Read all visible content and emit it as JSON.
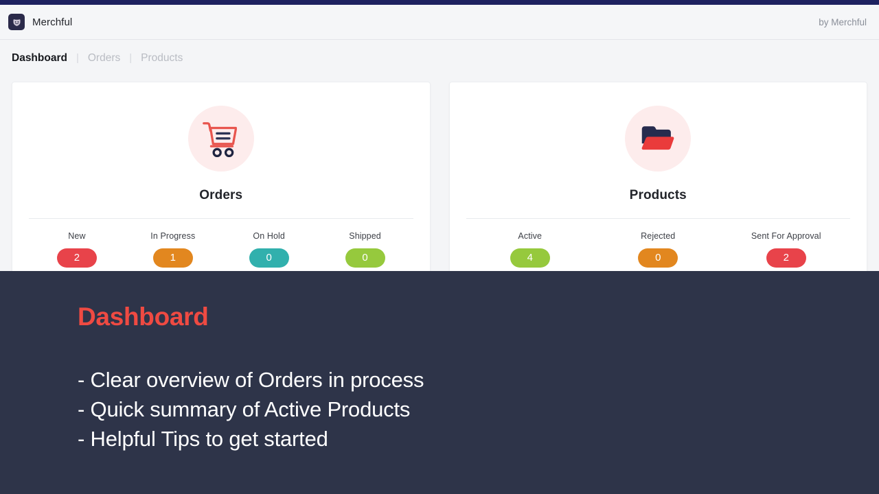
{
  "theme": {
    "navy_strip": "#1e2260",
    "overlay_bg": "#2e3449",
    "accent_red": "#ef4a42",
    "icon_circle_bg": "#fdecec"
  },
  "header": {
    "logo_icon": "merchful-mask-logo-icon",
    "brand_name": "Merchful",
    "attribution": "by Merchful"
  },
  "nav": {
    "separator": "|",
    "tabs": [
      {
        "label": "Dashboard",
        "active": true
      },
      {
        "label": "Orders",
        "active": false
      },
      {
        "label": "Products",
        "active": false
      }
    ]
  },
  "cards": [
    {
      "id": "orders",
      "icon": "shopping-cart-icon",
      "title": "Orders",
      "stats": [
        {
          "label": "New",
          "value": "2",
          "color": "#e8434a"
        },
        {
          "label": "In Progress",
          "value": "1",
          "color": "#e2871f"
        },
        {
          "label": "On Hold",
          "value": "0",
          "color": "#31b0ad"
        },
        {
          "label": "Shipped",
          "value": "0",
          "color": "#96c93d"
        }
      ]
    },
    {
      "id": "products",
      "icon": "folder-icon",
      "title": "Products",
      "stats": [
        {
          "label": "Active",
          "value": "4",
          "color": "#96c93d"
        },
        {
          "label": "Rejected",
          "value": "0",
          "color": "#e2871f"
        },
        {
          "label": "Sent For Approval",
          "value": "2",
          "color": "#e8434a"
        }
      ]
    }
  ],
  "overlay": {
    "title": "Dashboard",
    "bullets": [
      "- Clear overview of Orders in process",
      "- Quick summary of Active Products",
      "- Helpful Tips to get started"
    ]
  }
}
